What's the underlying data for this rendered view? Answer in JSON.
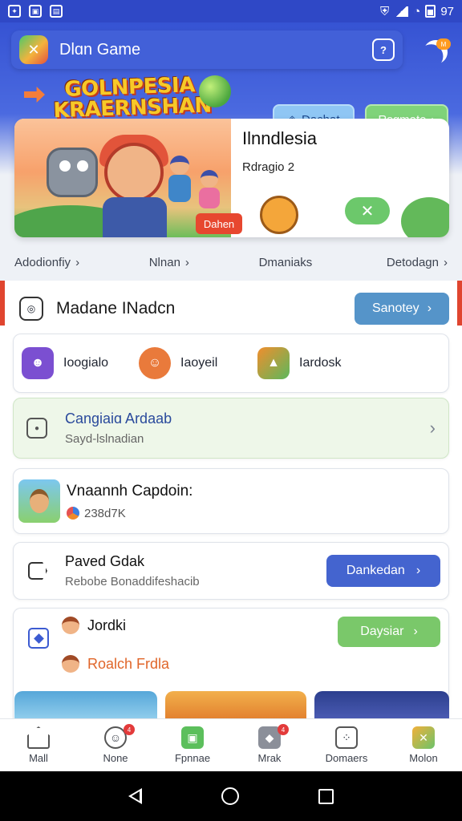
{
  "status_bar": {
    "time_right": "97",
    "left_icons": [
      "game-controller-icon",
      "image-icon",
      "calendar-icon"
    ]
  },
  "appbar": {
    "title": "Dlɑn Game",
    "logo_icon": "app-logo-icon"
  },
  "hero_pills": {
    "left": "Dachat",
    "right": "Rsgmate"
  },
  "banner": {
    "art_headline": "GOLNPESIA KRAERNSHAN",
    "tag": "Dahen",
    "title": "Ilnndlesia",
    "subtitle": "Rdragio 2",
    "close_symbol": "✕"
  },
  "categories": [
    {
      "label": "Adodionfiy",
      "chevron": "›"
    },
    {
      "label": "Nlnan",
      "chevron": "›"
    },
    {
      "label": "Dmaniaks",
      "chevron": ""
    },
    {
      "label": "Detodagn",
      "chevron": "›"
    }
  ],
  "section": {
    "title": "Madane INadcn",
    "button": "Sanotey"
  },
  "games_row": [
    {
      "label": "Ioogialo",
      "color": "#7b4fd1"
    },
    {
      "label": "Iaoyeil",
      "color": "#e97a3b"
    },
    {
      "label": "Iardosk",
      "color": "#f18e2d"
    }
  ],
  "card_campaign": {
    "title": "Cangiaiɑ Ardaab",
    "subtitle": "Sayd-lslnadian"
  },
  "card_captain": {
    "title": "Vnaannh Capdoin:",
    "subtitle": "238d7K"
  },
  "card_played": {
    "title": "Paved Gdak",
    "subtitle": "Rebobe Bonaddifeshacib",
    "button": "Dankedan"
  },
  "card_friends": {
    "row1": "Jordki",
    "row2": "Roalch Frdla",
    "button": "Daysiar"
  },
  "bottom_nav": [
    {
      "label": "Mall",
      "icon": "home-icon",
      "badge": ""
    },
    {
      "label": "None",
      "icon": "mascot-icon",
      "badge": "4"
    },
    {
      "label": "Fpnnae",
      "icon": "gift-icon",
      "badge": ""
    },
    {
      "label": "Mrak",
      "icon": "robot-icon",
      "badge": "4"
    },
    {
      "label": "Domaers",
      "icon": "dice-icon",
      "badge": ""
    },
    {
      "label": "Molon",
      "icon": "crossed-swords-icon",
      "badge": ""
    }
  ],
  "colors": {
    "primary": "#3653d3",
    "accent_red": "#e0452f",
    "button_blue": "#5594c9",
    "button_navy": "#4464cf",
    "button_green": "#7ac86a"
  }
}
